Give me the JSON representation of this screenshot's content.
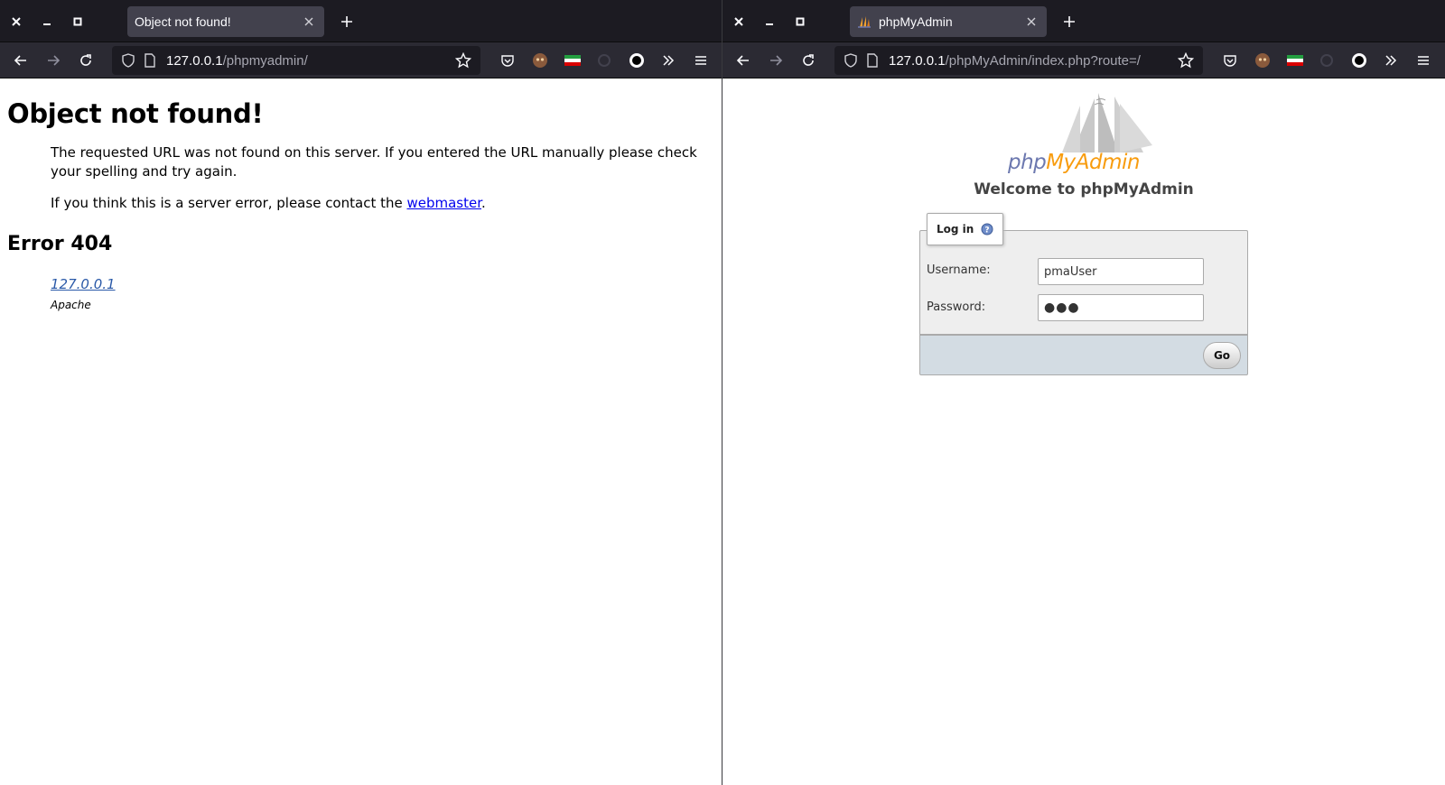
{
  "left": {
    "tab_title": "Object not found!",
    "url_host": "127.0.0.1",
    "url_path": "/phpmyadmin/",
    "heading": "Object not found!",
    "para1": "The requested URL was not found on this server. If you entered the URL manually please check your spelling and try again.",
    "para2_prefix": "If you think this is a server error, please contact the ",
    "para2_link": "webmaster",
    "para2_suffix": ".",
    "error_heading": "Error 404",
    "address_link": "127.0.0.1",
    "server_sig": "Apache"
  },
  "right": {
    "tab_title": "phpMyAdmin",
    "url_host": "127.0.0.1",
    "url_path": "/phpMyAdmin/index.php?route=/",
    "logo_php": "php",
    "logo_myadmin": "MyAdmin",
    "welcome": "Welcome to phpMyAdmin",
    "login_legend": "Log in",
    "username_label": "Username:",
    "username_value": "pmaUser",
    "password_label": "Password:",
    "password_value": "●●●",
    "go_label": "Go"
  },
  "icons": {
    "window_close": "close-icon",
    "window_minimize": "minimize-icon",
    "window_maximize": "maximize-icon",
    "tab_close": "close-icon",
    "new_tab": "plus-icon",
    "back": "back-arrow-icon",
    "forward": "forward-arrow-icon",
    "reload": "reload-icon",
    "shield": "shield-icon",
    "page": "page-icon",
    "bookmark": "star-icon",
    "pocket": "pocket-icon",
    "menu": "hamburger-icon",
    "overflow": "chevrons-right-icon"
  },
  "colors": {
    "tabbar_bg": "#1c1b22",
    "navbar_bg": "#2b2a33",
    "active_tab_bg": "#42414d",
    "link": "#0000ee",
    "pma_php": "#6c78af",
    "pma_myadmin": "#f89c0e",
    "fieldset_bg": "#eeeeee",
    "footer_bg": "#d3dce3"
  }
}
